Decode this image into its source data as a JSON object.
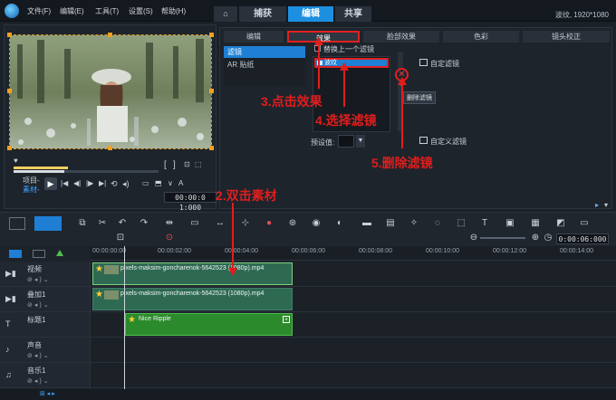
{
  "menu": {
    "file": "文件(F)",
    "edit": "编辑(E)",
    "tools": "工具(T)",
    "settings": "设置(S)",
    "help": "帮助(H)"
  },
  "main_tabs": {
    "capture": "捕获",
    "edit": "编辑",
    "share": "共享"
  },
  "project_info": "波纹, 1920*1080",
  "preview": {
    "project_label": "项目-",
    "clip_label": "素材-",
    "timecode": "00:00:0 1:000",
    "controls": [
      "[",
      "]",
      "◀◀",
      "▶",
      "◀|",
      "◀",
      "▶",
      "▶|",
      "⟲",
      "⟳"
    ],
    "ctrl_right": "A",
    "scrub_progress": 0.35
  },
  "options": {
    "tabs": [
      "编辑",
      "效果",
      "脸部效果",
      "色彩",
      "镜头校正"
    ],
    "side_items": [
      "滤镜",
      "AR 贴纸"
    ],
    "replace_last_filter": "替换上一个滤镜",
    "filter_item": "波纹",
    "auto_filter": "自定滤镜",
    "delete_filter_tip": "删除滤镜",
    "custom_filter": "自定义滤镜",
    "preset_label": "预设值:"
  },
  "annotations": {
    "step2": "2.双击素材",
    "step3": "3.点击效果",
    "step4": "4.选择滤镜",
    "step5": "5.删除滤镜"
  },
  "timeline": {
    "ruler_ticks": [
      "00:00:00:00",
      "00:00:02:00",
      "00:00:04:00",
      "00:00:06:00",
      "00:00:08:00",
      "00:00:10:00",
      "00:00:12:00",
      "00:00:14:00"
    ],
    "timecode": "0:00:06:000",
    "tracks": [
      {
        "name": "视频",
        "clip": "pixels-maksim-goncharenok-5642523 (1080p).mp4"
      },
      {
        "name": "叠加1",
        "clip": "pixels-maksim-goncharenok-5642523 (1080p).mp4"
      },
      {
        "name": "标题1",
        "clip": "Nice Ripple"
      },
      {
        "name": "声音",
        "clip": ""
      },
      {
        "name": "音乐1",
        "clip": ""
      }
    ]
  },
  "colors": {
    "accent": "#1d8fe0",
    "annotation": "#e11d1d",
    "clip_video": "#2e6a52",
    "clip_title": "#2b8a2b"
  },
  "icons": [
    "app-logo-icon",
    "home-icon",
    "filter-icon",
    "delete-icon",
    "play-icon",
    "star-icon"
  ]
}
